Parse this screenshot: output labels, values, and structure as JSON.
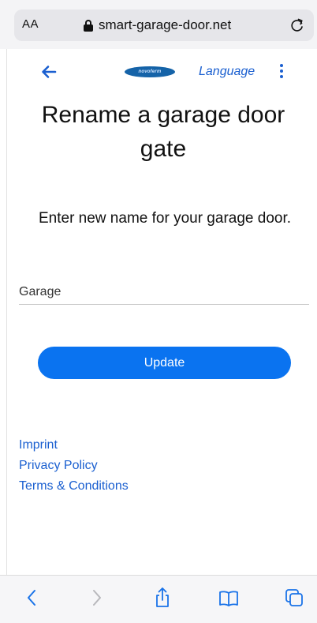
{
  "browser": {
    "aa_label": "AA",
    "url": "smart-garage-door.net"
  },
  "header": {
    "logo_text": "novoferm",
    "language_label": "Language"
  },
  "main": {
    "title": "Rename a garage door gate",
    "instruction": "Enter new name for your garage door.",
    "name_input_value": "Garage",
    "update_label": "Update"
  },
  "footer": {
    "links": [
      "Imprint",
      "Privacy Policy",
      "Terms & Conditions"
    ]
  },
  "colors": {
    "accent": "#0a73f0",
    "link": "#1a5fd0",
    "logo": "#1563a8"
  },
  "icons": {
    "toolbar": [
      "back-chevron-icon",
      "forward-chevron-icon",
      "share-icon",
      "bookmarks-icon",
      "tabs-icon"
    ]
  }
}
